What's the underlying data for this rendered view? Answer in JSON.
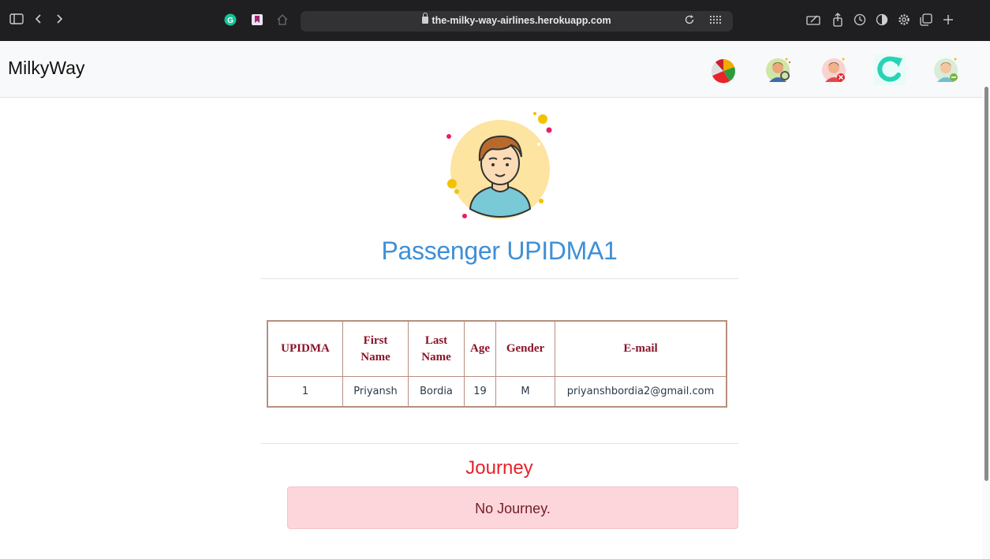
{
  "browser": {
    "url": "the-milky-way-airlines.herokuapp.com",
    "icons": [
      "sidebar-icon",
      "back-icon",
      "forward-icon",
      "grammarly-icon",
      "bookmark-extension-icon",
      "home-icon",
      "reload-icon",
      "grid-icon",
      "pencil-icon",
      "share-icon",
      "history-icon",
      "shield-icon",
      "settings-icon",
      "tabs-icon",
      "new-tab-icon"
    ]
  },
  "navbar": {
    "brand": "MilkyWay",
    "icons": [
      "pie-chart-icon",
      "user-search-icon",
      "remove-user-icon",
      "refresh-icon",
      "user-minus-icon"
    ]
  },
  "page": {
    "title": "Passenger UPIDMA1",
    "table": {
      "headers": [
        "UPIDMA",
        "First Name",
        "Last Name",
        "Age",
        "Gender",
        "E-mail"
      ],
      "rows": [
        [
          "1",
          "Priyansh",
          "Bordia",
          "19",
          "M",
          "priyanshbordia2@gmail.com"
        ]
      ]
    },
    "journey_title": "Journey",
    "journey_empty": "No Journey."
  },
  "colors": {
    "title": "#3f8fd6",
    "header_text": "#8b1228",
    "table_border": "#b78f7f",
    "journey_title": "#e8212a",
    "alert_bg": "#fdd6db",
    "alert_text": "#721c24"
  }
}
